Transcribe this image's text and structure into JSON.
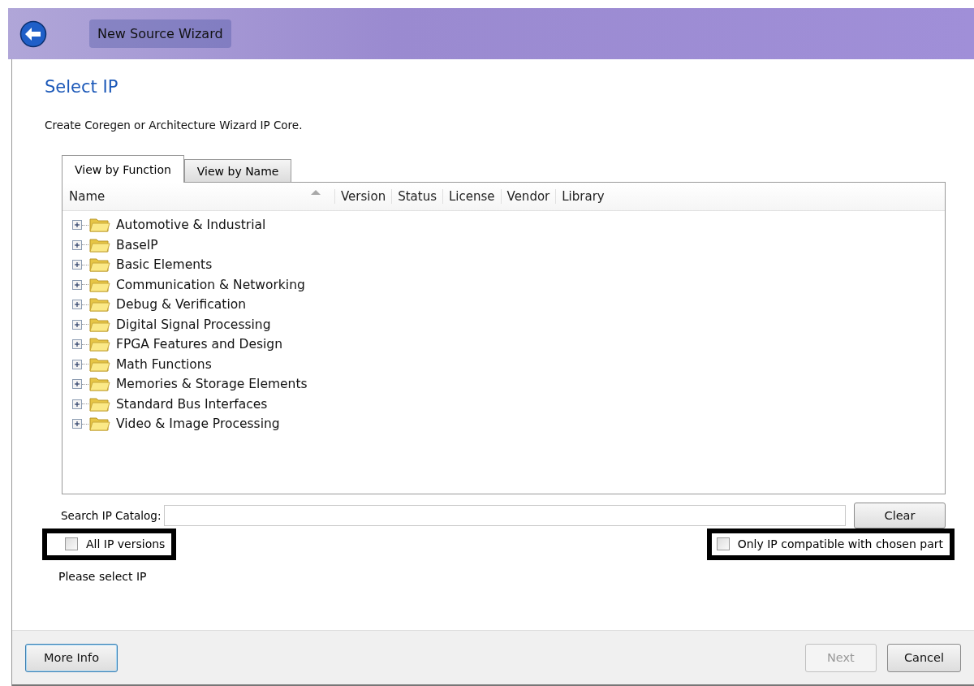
{
  "window": {
    "title": "New Source Wizard"
  },
  "page": {
    "heading": "Select IP",
    "description": "Create Coregen or Architecture Wizard IP Core."
  },
  "tabs": [
    {
      "label": "View by Function",
      "selected": true
    },
    {
      "label": "View by Name",
      "selected": false
    }
  ],
  "tree": {
    "columns": [
      "Name",
      "Version",
      "Status",
      "License",
      "Vendor",
      "Library"
    ],
    "items": [
      {
        "label": "Automotive & Industrial",
        "expanded": false
      },
      {
        "label": "BaseIP",
        "expanded": false
      },
      {
        "label": "Basic Elements",
        "expanded": false
      },
      {
        "label": "Communication & Networking",
        "expanded": false
      },
      {
        "label": "Debug & Verification",
        "expanded": false
      },
      {
        "label": "Digital Signal Processing",
        "expanded": false
      },
      {
        "label": "FPGA Features and Design",
        "expanded": false
      },
      {
        "label": "Math Functions",
        "expanded": false
      },
      {
        "label": "Memories & Storage Elements",
        "expanded": false
      },
      {
        "label": "Standard Bus Interfaces",
        "expanded": false
      },
      {
        "label": "Video & Image Processing",
        "expanded": false
      }
    ]
  },
  "search": {
    "label": "Search IP Catalog:",
    "button": "Clear"
  },
  "options": [
    {
      "label": "All IP versions",
      "checked": false,
      "highlighted": true
    },
    {
      "label": "Only IP compatible with chosen part",
      "checked": false,
      "highlighted": true
    }
  ],
  "status_text": "Please select IP",
  "buttons": [
    {
      "label": "More Info",
      "disabled": false,
      "focused": true
    },
    {
      "label": "Next",
      "disabled": true,
      "focused": false
    },
    {
      "label": "Cancel",
      "disabled": false,
      "focused": false
    }
  ]
}
